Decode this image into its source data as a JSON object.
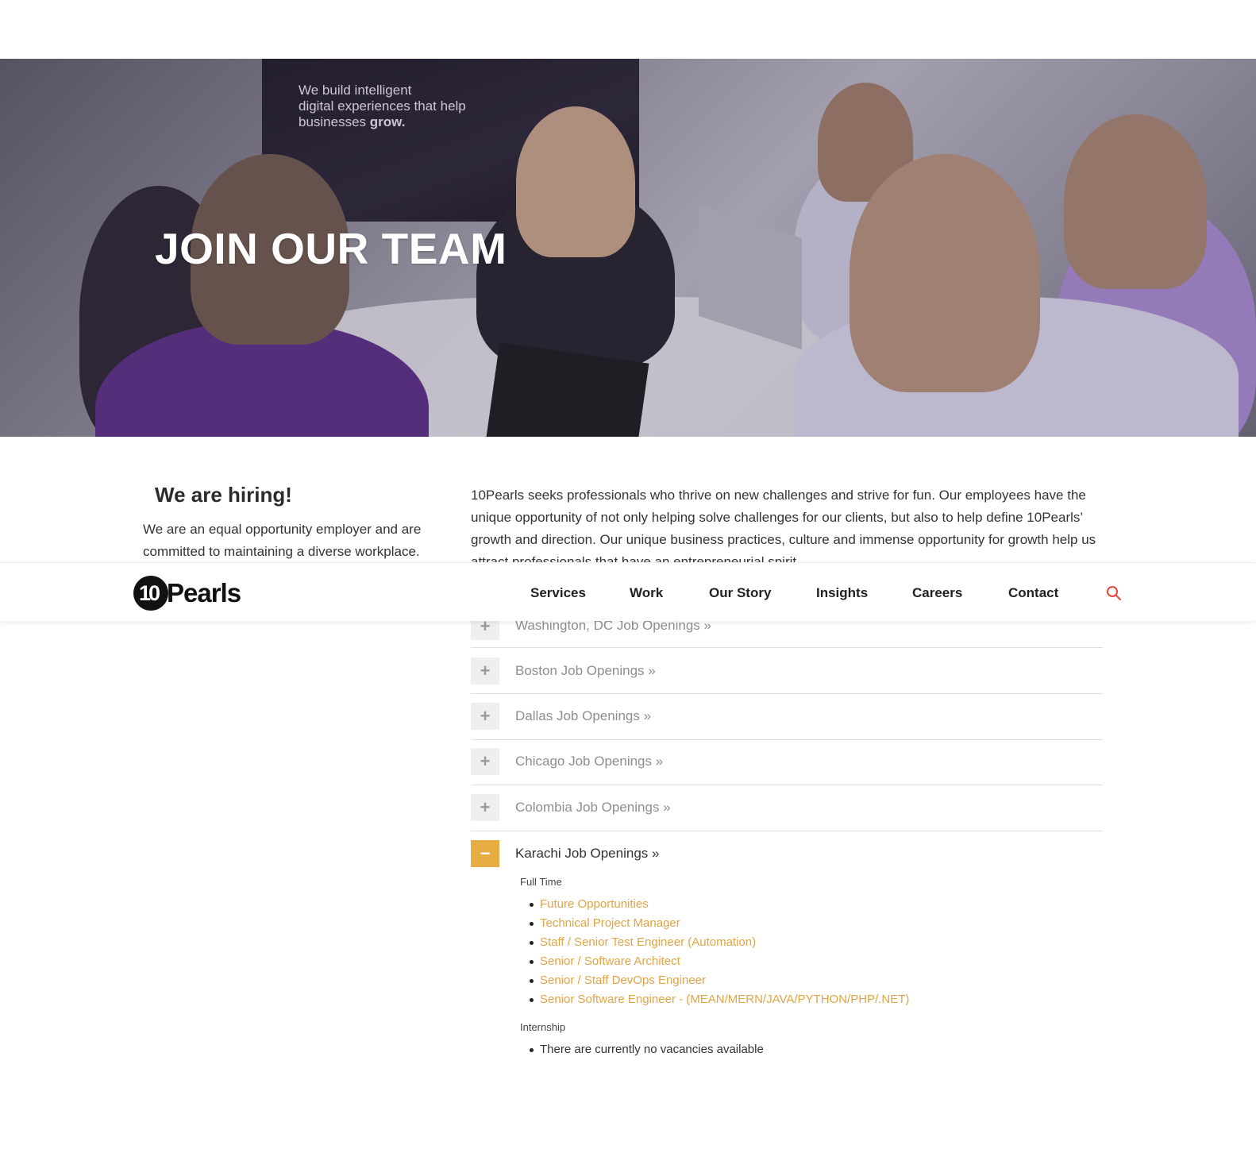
{
  "hero": {
    "title": "JOIN OUR TEAM",
    "screen_text_1": "We build intelligent",
    "screen_text_2": "digital experiences that help",
    "screen_text_3": "businesses ",
    "screen_text_bold": "grow."
  },
  "intro": {
    "hiring_title": "We are hiring!",
    "hiring_text": "We are an equal opportunity employer and are committed to maintaining a diverse workplace.",
    "description": "10Pearls seeks professionals who thrive on new challenges and strive for fun. Our employees have the unique opportunity of not only helping solve challenges for our clients, but also to help define 10Pearls’ growth and direction. Our unique business practices, culture and immense opportunity for growth help us attract professionals that have an entrepreneurial spirit."
  },
  "header": {
    "logo_mark": "10",
    "logo_word": "Pearls",
    "nav": [
      "Services",
      "Work",
      "Our Story",
      "Insights",
      "Careers",
      "Contact"
    ],
    "accent_color": "#e8453c"
  },
  "accordion": [
    {
      "label": "Washington, DC Job Openings »",
      "expanded": false,
      "toggle": "+"
    },
    {
      "label": "Boston Job Openings »",
      "expanded": false,
      "toggle": "+"
    },
    {
      "label": "Dallas Job Openings »",
      "expanded": false,
      "toggle": "+"
    },
    {
      "label": "Chicago Job Openings »",
      "expanded": false,
      "toggle": "+"
    },
    {
      "label": "Colombia Job Openings »",
      "expanded": false,
      "toggle": "+"
    },
    {
      "label": "Karachi Job Openings »",
      "expanded": true,
      "toggle": "−"
    }
  ],
  "karachi": {
    "full_time_label": "Full Time",
    "full_time_jobs": [
      "Future Opportunities",
      "Technical Project Manager",
      "Staff / Senior Test Engineer (Automation)",
      "Senior / Software Architect",
      "Senior / Staff DevOps Engineer",
      "Senior Software Engineer - (MEAN/MERN/JAVA/PYTHON/PHP/.NET)"
    ],
    "internship_label": "Internship",
    "internship_jobs": [
      "There are currently no vacancies available"
    ]
  },
  "colors": {
    "accent_gold": "#e8ad42",
    "link_gold": "#e2a445",
    "search_red": "#e8453c"
  }
}
